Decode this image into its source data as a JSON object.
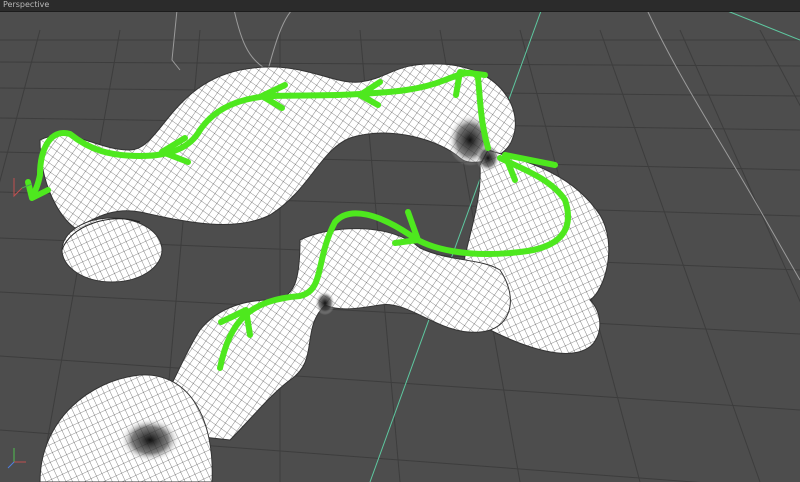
{
  "viewport": {
    "label": "Perspective",
    "background": "#4d4d4d"
  },
  "scene": {
    "mesh_color": "#ffffff",
    "wire_color": "#1a1a1a",
    "arrow_color": "#4ee81e",
    "grid_color": "#404040",
    "axis_color": "#58c49c"
  },
  "icons": [
    "axis-gizmo-icon",
    "flow-arrow-icon"
  ]
}
